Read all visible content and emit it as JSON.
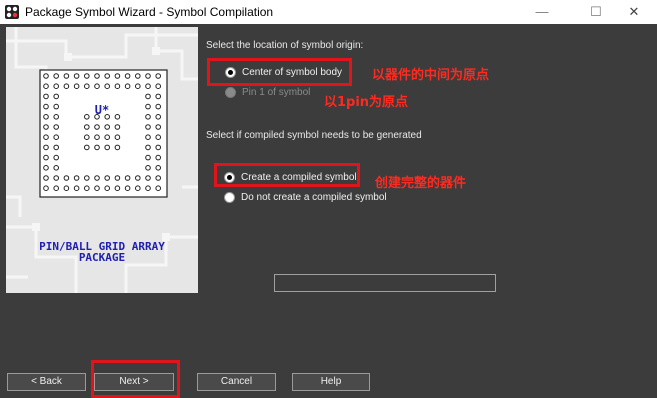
{
  "window": {
    "title": "Package Symbol Wizard - Symbol Compilation",
    "minimize_glyph": "—",
    "maximize_glyph": "☐",
    "close_glyph": "✕"
  },
  "side_panel": {
    "part_label": "U*",
    "caption_line1": "PIN/BALL GRID ARRAY",
    "caption_line2": "PACKAGE"
  },
  "origin": {
    "prompt": "Select the location of symbol origin:",
    "options": [
      {
        "label": "Center of symbol body",
        "selected": true,
        "enabled": true
      },
      {
        "label": "Pin 1 of symbol",
        "selected": false,
        "enabled": false
      }
    ]
  },
  "compile": {
    "prompt": "Select if compiled symbol needs to be generated",
    "options": [
      {
        "label": "Create a compiled symbol",
        "selected": true,
        "enabled": true
      },
      {
        "label": "Do not create a compiled symbol",
        "selected": false,
        "enabled": true
      }
    ]
  },
  "annotations": {
    "center_note": "以器件的中间为原点",
    "pin1_note": "以1pin为原点",
    "compiled_note": "创建完整的器件"
  },
  "progress": {
    "value": 0
  },
  "buttons": {
    "back": "< Back",
    "next": "Next >",
    "cancel": "Cancel",
    "help": "Help"
  },
  "colors": {
    "background": "#3c3c3c",
    "highlight_red": "#e0141b",
    "annotation_red": "#ff2a1f",
    "panel_text_blue": "#2020b0"
  }
}
